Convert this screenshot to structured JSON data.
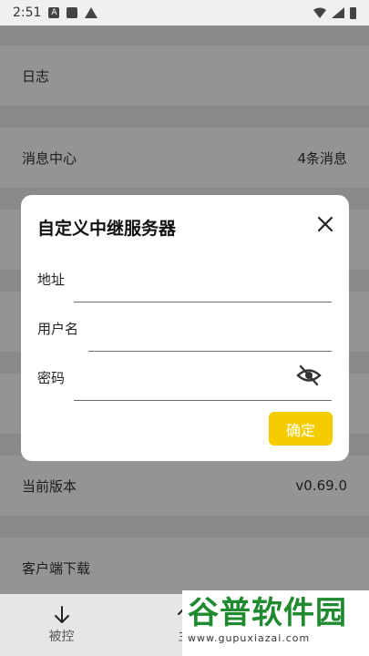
{
  "status_bar": {
    "time": "2:51"
  },
  "list": {
    "items": [
      {
        "label": "日志",
        "value": ""
      },
      {
        "label": "消息中心",
        "value": "4条消息"
      },
      {
        "label": "当前版本",
        "value": "v0.69.0"
      },
      {
        "label": "客户端下载",
        "value": ""
      }
    ]
  },
  "dialog": {
    "title": "自定义中继服务器",
    "fields": [
      {
        "label": "地址",
        "value": ""
      },
      {
        "label": "用户名",
        "value": ""
      },
      {
        "label": "密码",
        "value": ""
      }
    ],
    "confirm_label": "确定"
  },
  "bottom_nav": {
    "items": [
      {
        "label": "被控"
      },
      {
        "label": "主"
      }
    ]
  },
  "watermark": {
    "title": "谷普软件园",
    "url": "www.gupuxiazai.com"
  },
  "colors": {
    "accent": "#f5cc00",
    "watermark": "#1f8a2f"
  }
}
